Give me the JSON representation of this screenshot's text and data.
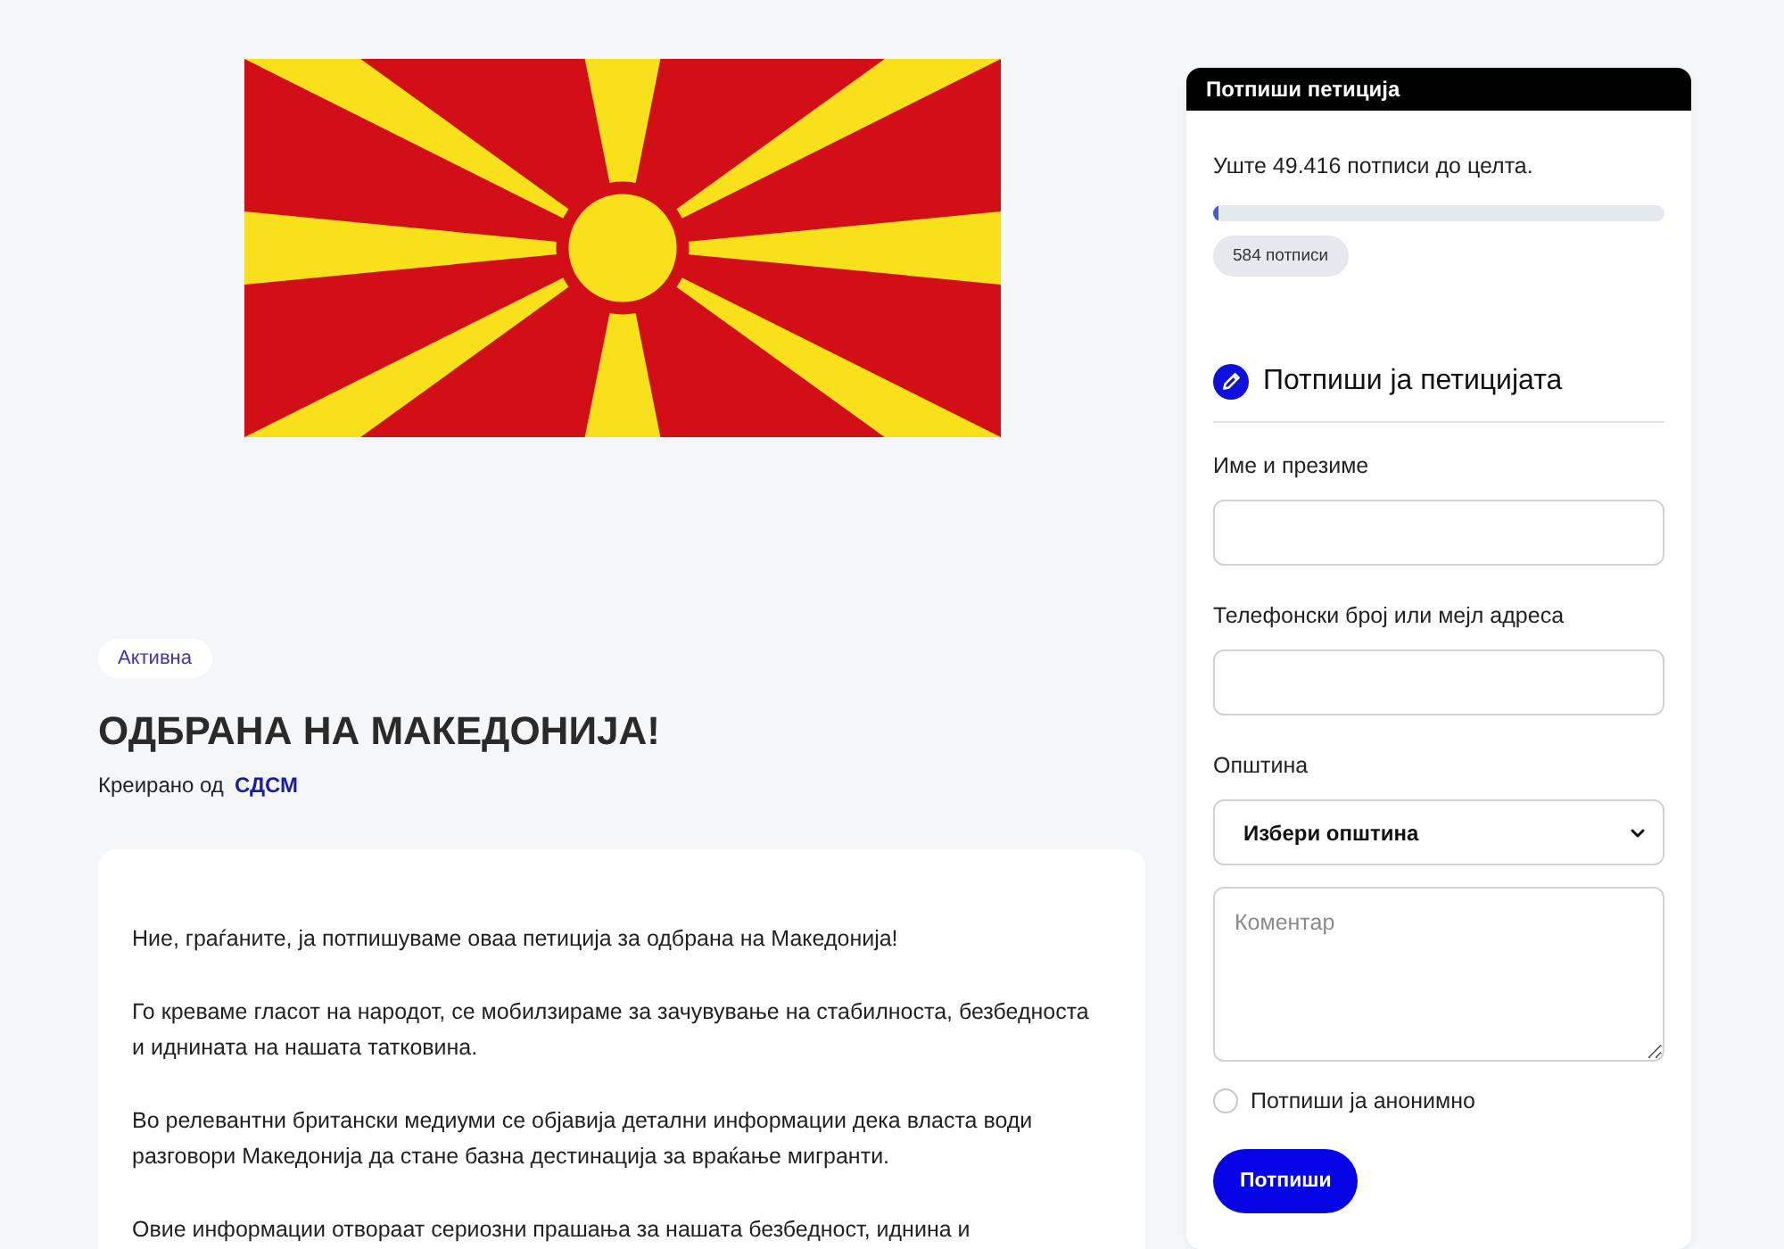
{
  "status_badge": "Активна",
  "title": "ОДБРАНА НА МАКЕДОНИЈА!",
  "byline": {
    "label": "Креирано од",
    "author": "СДСМ"
  },
  "body": {
    "paragraphs": [
      "Ние, граѓаните, ја потпишуваме оваа петиција за одбрана на Македонија!",
      "Го креваме гласот на народот, се мобилзираме за зачувување на стабилноста, безбедноста и иднината на нашата татковина.",
      "Во релевантни британски медиуми се објавија детални информации дека власта води разговори Македонија да стане базна дестинација за враќање мигранти.",
      "Овие информации отвораат сериозни прашања за нашата безбедност, иднина и"
    ]
  },
  "sign_panel": {
    "header": "Потпиши петиција",
    "remaining": "Уште 49.416 потписи до целта.",
    "progress": {
      "level": 0.012
    },
    "count": "584 потписи",
    "form_title": "Потпиши ја петицијата",
    "fields": [
      {
        "kind": "text",
        "label": "Име и презиме"
      },
      {
        "kind": "text",
        "label": "Телефонски број или мејл адреса"
      },
      {
        "kind": "select",
        "label": "Општина",
        "value": "Избери општина"
      },
      {
        "kind": "textarea",
        "placeholder": "Коментар"
      }
    ],
    "anonymous": {
      "label": "Потпиши ја анонимно",
      "checked": false
    },
    "submit": "Потпиши"
  }
}
